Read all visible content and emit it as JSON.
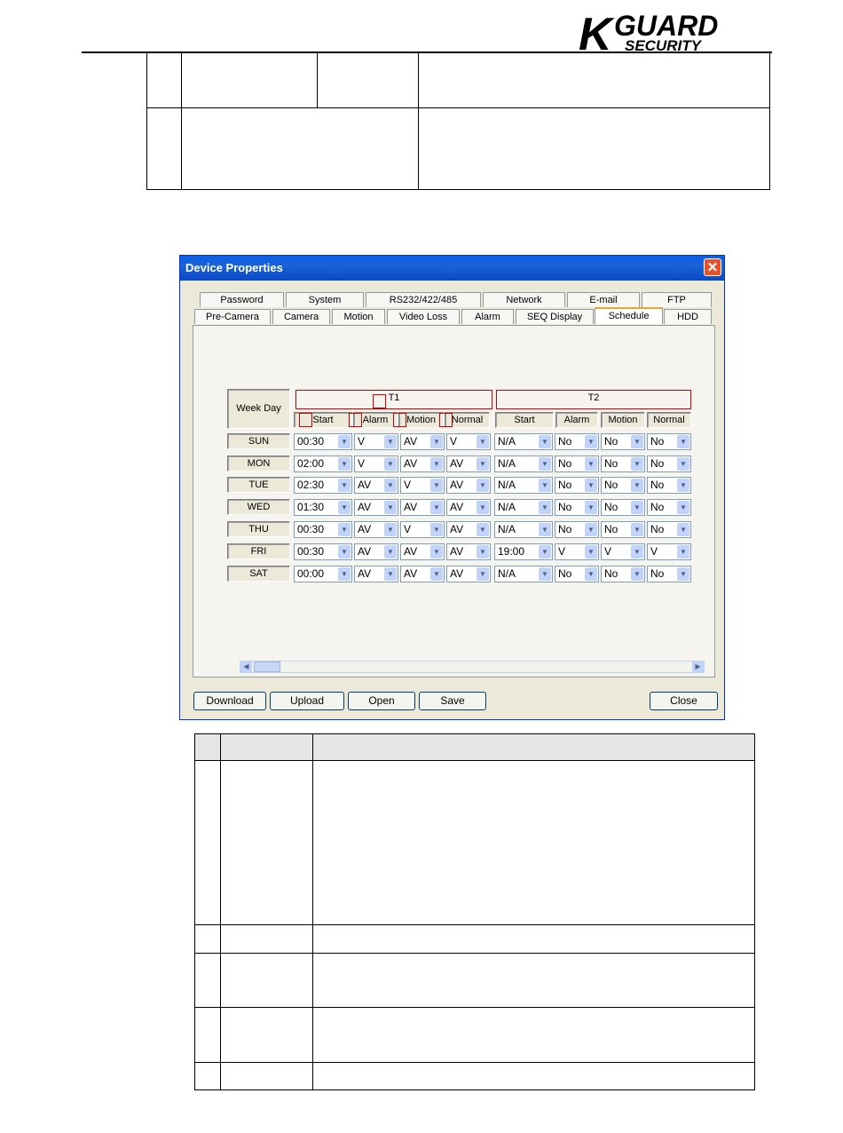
{
  "dialog": {
    "title": "Device Properties",
    "close_glyph": "✕",
    "tabs_row1": [
      "Password",
      "System",
      "RS232/422/485",
      "Network",
      "E-mail",
      "FTP"
    ],
    "tabs_row2": [
      "Pre-Camera",
      "Camera",
      "Motion",
      "Video Loss",
      "Alarm",
      "SEQ Display",
      "Schedule",
      "HDD"
    ],
    "active_tab": "Schedule",
    "week_day_header": "Week Day",
    "t1_label": "T1",
    "t2_label": "T2",
    "col_headers": [
      "Start",
      "Alarm",
      "Motion",
      "Normal"
    ],
    "rows": [
      {
        "day": "SUN",
        "t1": [
          "00:30",
          "V",
          "AV",
          "V"
        ],
        "t2": [
          "N/A",
          "No",
          "No",
          "No"
        ]
      },
      {
        "day": "MON",
        "t1": [
          "02:00",
          "V",
          "AV",
          "AV"
        ],
        "t2": [
          "N/A",
          "No",
          "No",
          "No"
        ]
      },
      {
        "day": "TUE",
        "t1": [
          "02:30",
          "AV",
          "V",
          "AV"
        ],
        "t2": [
          "N/A",
          "No",
          "No",
          "No"
        ]
      },
      {
        "day": "WED",
        "t1": [
          "01:30",
          "AV",
          "AV",
          "AV"
        ],
        "t2": [
          "N/A",
          "No",
          "No",
          "No"
        ]
      },
      {
        "day": "THU",
        "t1": [
          "00:30",
          "AV",
          "V",
          "AV"
        ],
        "t2": [
          "N/A",
          "No",
          "No",
          "No"
        ]
      },
      {
        "day": "FRI",
        "t1": [
          "00:30",
          "AV",
          "AV",
          "AV"
        ],
        "t2": [
          "19:00",
          "V",
          "V",
          "V"
        ]
      },
      {
        "day": "SAT",
        "t1": [
          "00:00",
          "AV",
          "AV",
          "AV"
        ],
        "t2": [
          "N/A",
          "No",
          "No",
          "No"
        ]
      }
    ],
    "buttons": {
      "download": "Download",
      "upload": "Upload",
      "open": "Open",
      "save": "Save",
      "close": "Close"
    }
  },
  "logo": {
    "big_k": "K",
    "word": "GUARD",
    "sub": "SECURITY",
    "color": "#000000"
  }
}
